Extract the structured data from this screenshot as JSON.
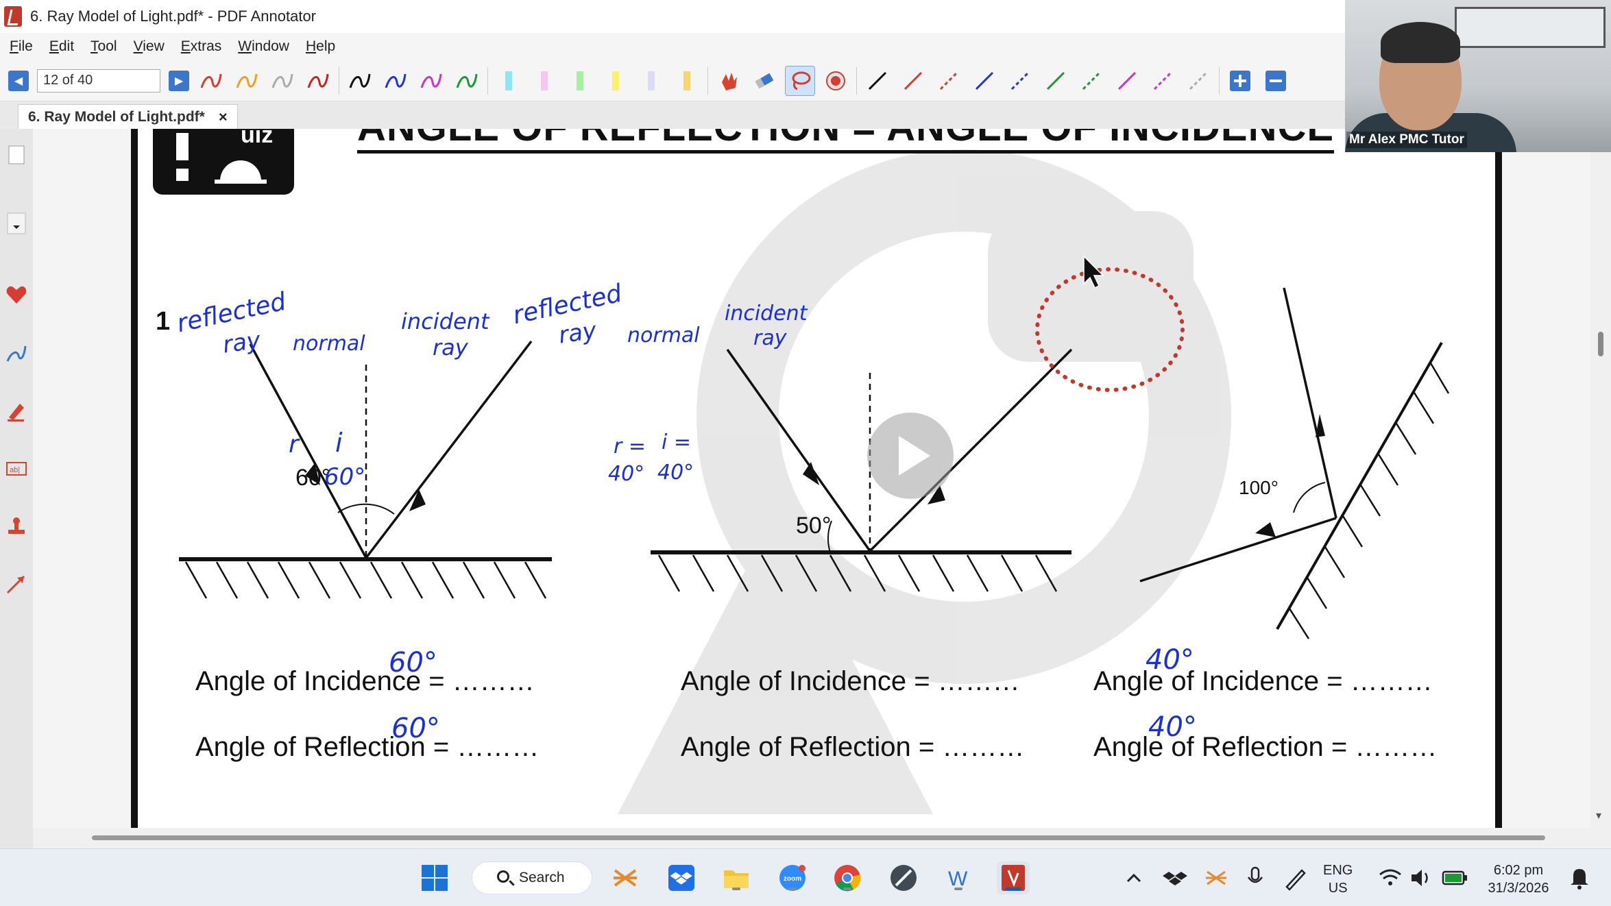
{
  "window": {
    "title": "6. Ray Model of Light.pdf* - PDF Annotator"
  },
  "menu": [
    "File",
    "Edit",
    "Tool",
    "View",
    "Extras",
    "Window",
    "Help"
  ],
  "toolbar": {
    "page_field": "12 of 40"
  },
  "tab": {
    "label": "6. Ray Model of Light.pdf*",
    "close": "×"
  },
  "document": {
    "heading": "ANGLE OF REFLECTION = ANGLE OF INCIDENCE",
    "question_number": "1",
    "diagram1": {
      "angle_label": "60°"
    },
    "diagram2": {
      "angle_label": "50°"
    },
    "diagram3": {
      "angle_label": "100°"
    },
    "answers": {
      "incidence_1": "Angle of Incidence = ………",
      "reflection_1": "Angle of Reflection = ………",
      "incidence_2": "Angle of Incidence = ………",
      "reflection_2": "Angle of Reflection = ………",
      "incidence_3": "Angle of Incidence = ………",
      "reflection_3": "Angle of Reflection = ………"
    },
    "handwriting": {
      "reflected_ray": "reflected",
      "ray": "ray",
      "normal": "normal",
      "incident": "incident",
      "r": "r",
      "i": "i",
      "angle60": "60°",
      "r_eq": "r =",
      "i_eq": "i =",
      "angle40": "40°",
      "answer60": "60°",
      "answer40": "40°"
    }
  },
  "webcam": {
    "name": "Mr Alex PMC Tutor"
  },
  "taskbar": {
    "search": "Search",
    "language_top": "ENG",
    "language_bottom": "US",
    "time": "6:02 pm",
    "date": "31/3/2026"
  }
}
